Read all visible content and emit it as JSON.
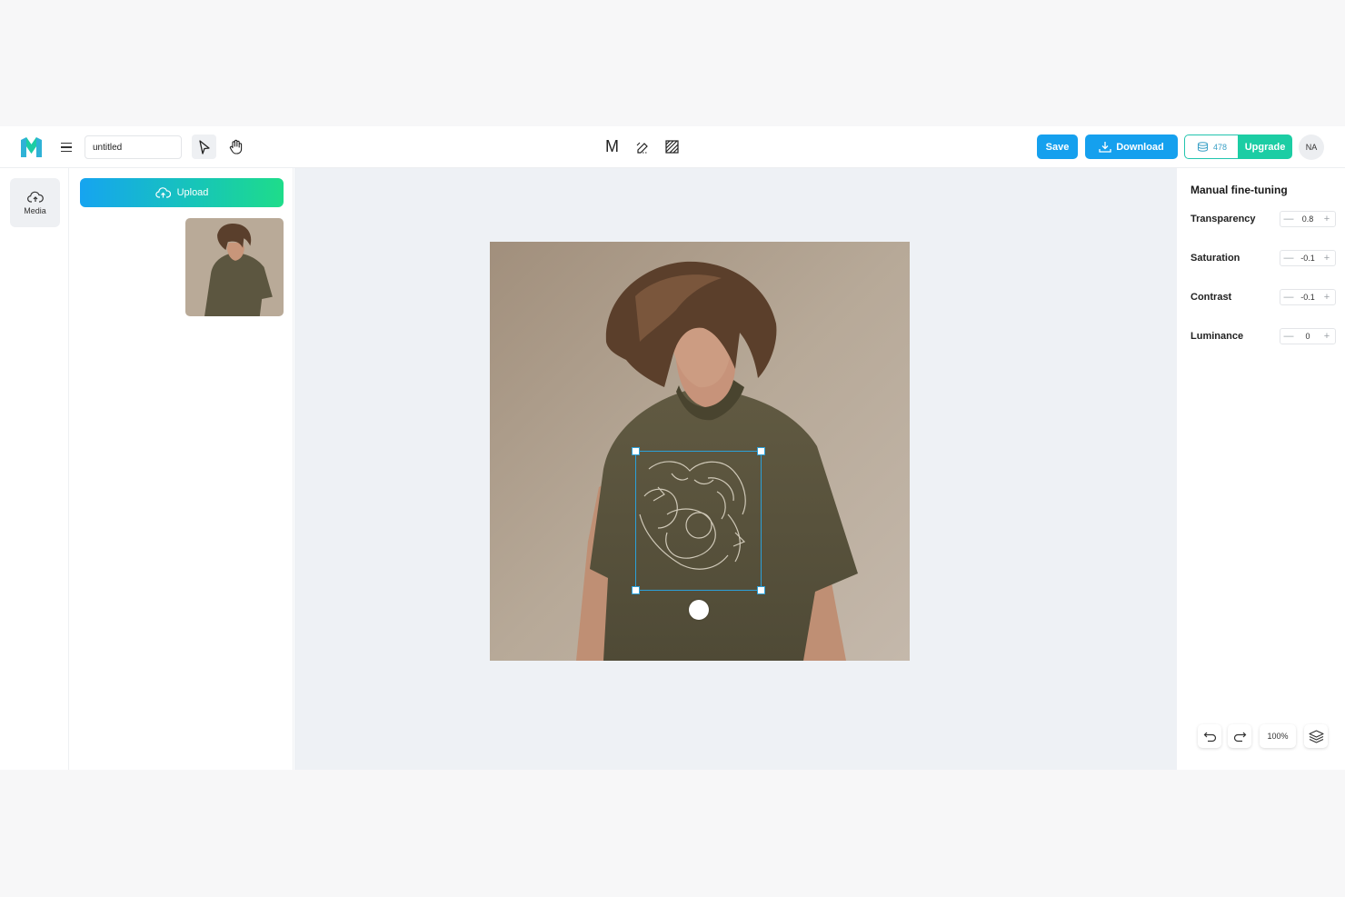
{
  "app": {
    "logo_icon": "brand-logo-m-icon",
    "brand_colors": {
      "teal": "#1ccda4",
      "blue": "#15a0ee"
    }
  },
  "header": {
    "document_title": "untitled",
    "tools": [
      "select-arrow-icon",
      "hand-pan-icon"
    ],
    "center_tools": [
      "m-text-icon",
      "eraser-icon",
      "pattern-icon"
    ],
    "center_m_label": "M",
    "save_label": "Save",
    "download_label": "Download",
    "credits": "478",
    "upgrade_label": "Upgrade",
    "avatar_initials": "NA"
  },
  "sidebar": {
    "items": [
      {
        "label": "Media",
        "icon": "cloud-icon"
      }
    ]
  },
  "media_panel": {
    "upload_label": "Upload",
    "images": [
      {
        "alt": "model in olive t-shirt"
      }
    ]
  },
  "canvas": {
    "selected_layer": "dragon-graphic"
  },
  "adjustments": {
    "title": "Manual fine-tuning",
    "rows": [
      {
        "label": "Transparency",
        "value": "0.8"
      },
      {
        "label": "Saturation",
        "value": "-0.1"
      },
      {
        "label": "Contrast",
        "value": "-0.1"
      },
      {
        "label": "Luminance",
        "value": "0"
      }
    ]
  },
  "bottom_tools": {
    "zoom": "100%",
    "undo_icon": "undo-icon",
    "redo_icon": "redo-icon",
    "layers_icon": "layers-icon"
  }
}
